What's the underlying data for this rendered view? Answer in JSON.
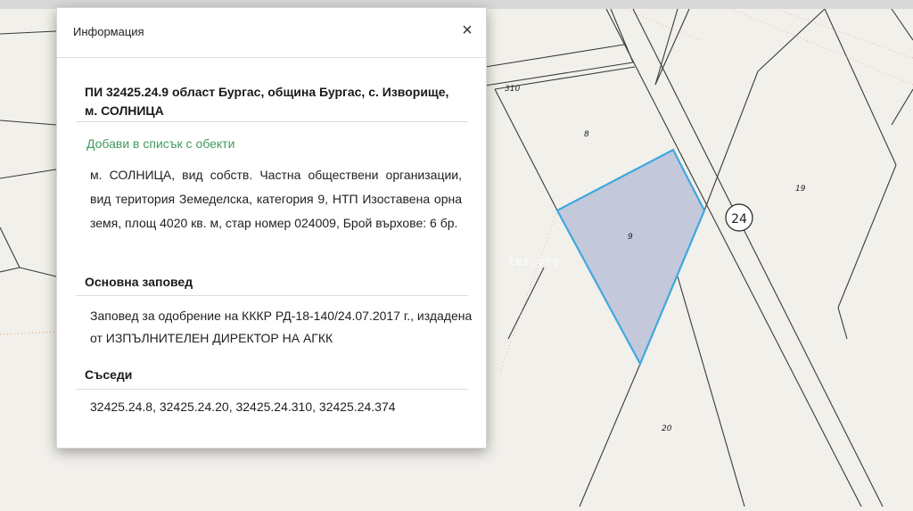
{
  "map": {
    "parcel_labels": {
      "p310": "310",
      "p8": "8",
      "p9": "9",
      "p19": "19",
      "p20": "20"
    },
    "road_badge": "24",
    "watermark": "tes.org",
    "colors": {
      "background": "#f2f0eb",
      "parcel_lines": "#3a3a3a",
      "selected_fill": "#c3c8da",
      "selected_stroke": "#3fa8e0"
    }
  },
  "panel": {
    "title": "Информация",
    "close_icon": "×",
    "pi_title": "ПИ 32425.24.9 област Бургас, община Бургас, с. Изворище, м. СОЛНИЦА",
    "add_link": "Добави в списък с обекти",
    "description": "м. СОЛНИЦА, вид собств. Частна обществени организации, вид територия Земеделска, категория 9, НТП Изоставена орна земя, площ 4020 кв. м, стар номер 024009, Брой върхове: 6 бр.",
    "order_heading": "Основна заповед",
    "order_text": "Заповед за одобрение на КККР РД-18-140/24.07.2017 г., издадена от ИЗПЪЛНИТЕЛЕН ДИРЕКТОР НА АГКК",
    "neighbors_heading": "Съседи",
    "neighbors_text": "32425.24.8, 32425.24.20, 32425.24.310, 32425.24.374",
    "colors": {
      "link": "#3f9a5c"
    }
  }
}
